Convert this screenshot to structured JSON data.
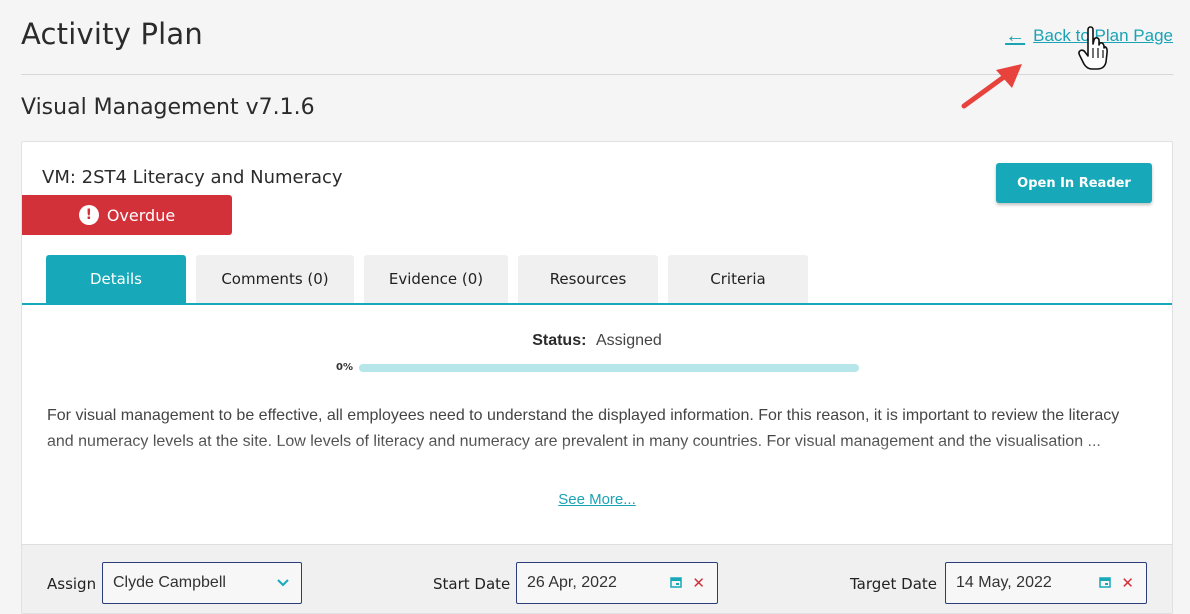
{
  "header": {
    "title": "Activity Plan",
    "back_label": "Back to Plan Page",
    "back_icon": "arrow-left-icon"
  },
  "plan": {
    "name": "Visual Management v7.1.6"
  },
  "activity": {
    "title": "VM: 2ST4 Literacy and Numeracy",
    "open_reader_label": "Open In Reader",
    "badge": {
      "label": "Overdue",
      "icon": "!",
      "color": "#d23139"
    }
  },
  "tabs": [
    {
      "label": "Details",
      "active": true
    },
    {
      "label": "Comments (0)",
      "active": false
    },
    {
      "label": "Evidence (0)",
      "active": false
    },
    {
      "label": "Resources",
      "active": false
    },
    {
      "label": "Criteria",
      "active": false
    }
  ],
  "details": {
    "status_label": "Status:",
    "status_value": "Assigned",
    "progress_label": "0%",
    "progress_fraction": 0,
    "description": "For visual management to be effective, all employees need to understand the displayed information. For this reason, it is important to review the literacy and numeracy levels at the site. Low levels of literacy and numeracy are prevalent in many countries. For visual management and the visualisation ...",
    "see_more_label": "See More..."
  },
  "form": {
    "assign_label": "Assign",
    "assign_value": "Clyde Campbell",
    "start_label": "Start Date",
    "start_value": "26 Apr, 2022",
    "target_label": "Target Date",
    "target_value": "14 May, 2022"
  },
  "colors": {
    "accent": "#17a9b9",
    "overdue": "#d23139",
    "annotation_arrow": "#e8423c"
  }
}
